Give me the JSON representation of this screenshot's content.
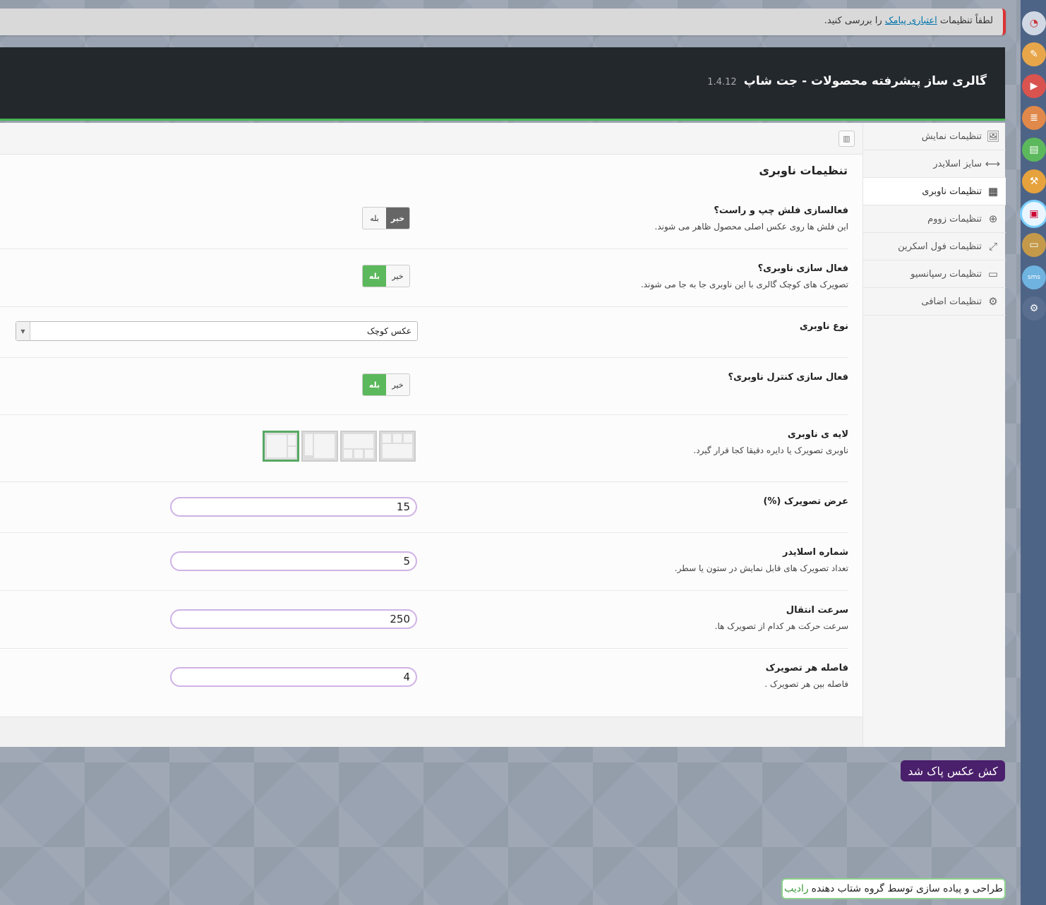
{
  "notice": {
    "prefix": "لطفاً تنظیمات",
    "link": "اعتباری پیامک",
    "suffix": "را بررسی کنید."
  },
  "header": {
    "title": "گالری ساز پیشرفته محصولات - جت شاپ",
    "version": "1.4.12"
  },
  "tabs": [
    {
      "label": "تنظیمات نمایش",
      "icon": "image-icon"
    },
    {
      "label": "سایز اسلایدر",
      "icon": "arrows-horizontal-icon"
    },
    {
      "label": "تنظیمات ناوبری",
      "icon": "grid-icon",
      "active": true
    },
    {
      "label": "تنظیمات زووم",
      "icon": "zoom-icon"
    },
    {
      "label": "تنظیمات فول اسکرین",
      "icon": "expand-icon"
    },
    {
      "label": "تنظیمات رسپانسیو",
      "icon": "monitor-icon"
    },
    {
      "label": "تنظیمات اضافی",
      "icon": "gear-icon"
    }
  ],
  "section_title": "تنظیمات ناوبری",
  "toggle_labels": {
    "no": "خیر",
    "yes": "بله"
  },
  "rows": {
    "arrows": {
      "title": "فعالسازی فلش چپ و راست؟",
      "desc": "این فلش ها روی عکس اصلی محصول ظاهر می شوند.",
      "value": "خیر"
    },
    "nav_enable": {
      "title": "فعال سازی ناوبری؟",
      "desc": "تصویرک های کوچک گالری با این ناوبری جا به جا می شوند.",
      "value": "بله"
    },
    "nav_type": {
      "title": "نوع ناوبری",
      "value": "عکس کوچک"
    },
    "nav_control": {
      "title": "فعال سازی کنترل ناوبری؟",
      "value": "بله"
    },
    "nav_layout": {
      "title": "لایه ی ناوبری",
      "desc": "ناوبری تصویرک یا دایره دقیقا کجا قرار گیرد."
    },
    "thumb_width": {
      "title": "عرض تصویرک (%)",
      "value": "15"
    },
    "slider_count": {
      "title": "شماره اسلایدر",
      "desc": "تعداد تصویرک های قابل نمایش در ستون یا سطر.",
      "value": "5"
    },
    "speed": {
      "title": "سرعت انتقال",
      "desc": "سرعت حرکت هر کدام از تصویرک ها.",
      "value": "250"
    },
    "spacing": {
      "title": "فاصله هر تصویرک",
      "desc": "فاصله بین هر تصویرک .",
      "value": "4"
    }
  },
  "cache_badge": "کش عکس پاک شد",
  "credit": {
    "text": "طراحی و پیاده سازی توسط گروه شتاب دهنده",
    "brand": "رادیب"
  },
  "colors": {
    "header_bg": "#23282d",
    "accent_green": "#5cb85c",
    "badge_purple": "#4a1f6b",
    "admin_sidebar": "#4e6486",
    "notice_border": "#dc3232"
  }
}
